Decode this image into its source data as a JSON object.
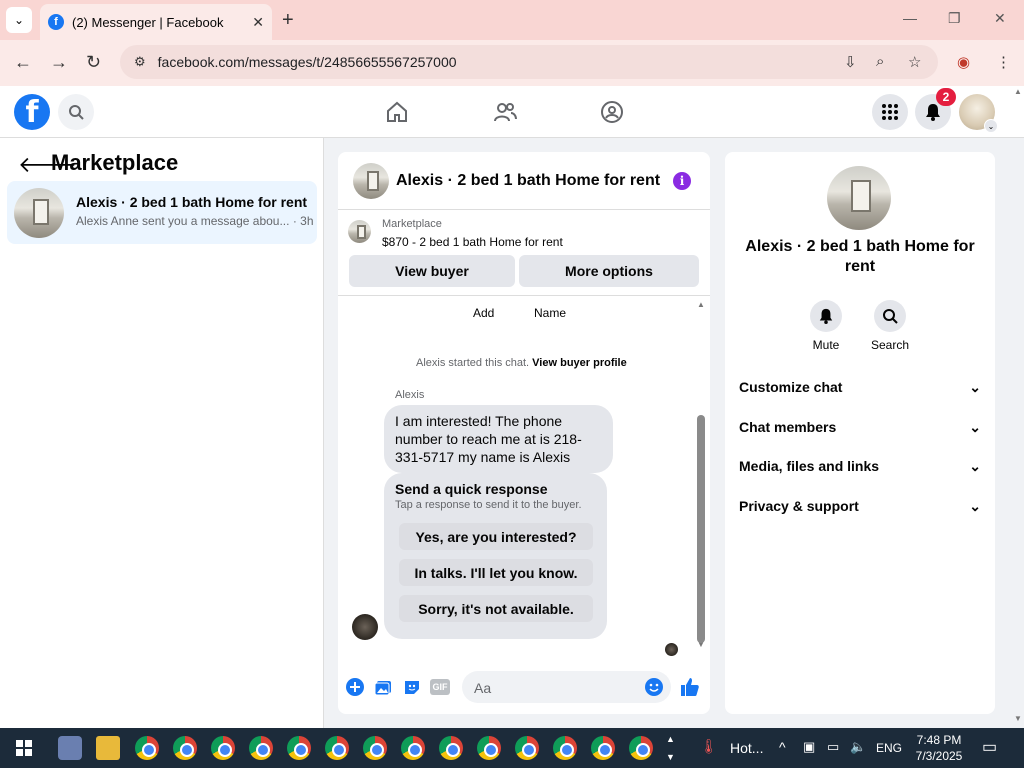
{
  "browser": {
    "tab_title": "(2) Messenger | Facebook",
    "url": "facebook.com/messages/t/24856655567257000"
  },
  "header": {
    "notification_count": "2"
  },
  "left_panel": {
    "title": "Marketplace",
    "conversation": {
      "name": "Alexis · 2 bed 1 bath Home for rent",
      "preview": "Alexis Anne sent you a message abou...",
      "time": "· 3h"
    }
  },
  "chat": {
    "title": "Alexis · 2 bed 1 bath Home for rent",
    "listing_source": "Marketplace",
    "listing_price": "$870 - 2 bed 1 bath Home for rent",
    "view_buyer": "View buyer",
    "more_options": "More options",
    "add_label": "Add",
    "name_label": "Name",
    "system_message": "Alexis started this chat.",
    "view_buyer_profile": "View buyer profile",
    "sender": "Alexis",
    "message": "I am interested! The phone number to reach me at is 218-331-5717 my name is Alexis",
    "quick_response_title": "Send a quick response",
    "quick_response_sub": "Tap a response to send it to the buyer.",
    "quick_responses": [
      "Yes, are you interested?",
      "In talks. I'll let you know.",
      "Sorry, it's not available."
    ],
    "input_placeholder": "Aa",
    "gif_label": "GIF"
  },
  "right_panel": {
    "name": "Alexis · 2 bed 1 bath Home for rent",
    "mute": "Mute",
    "search": "Search",
    "sections": [
      "Customize chat",
      "Chat members",
      "Media, files and links",
      "Privacy & support"
    ]
  },
  "taskbar": {
    "weather": "Hot...",
    "language": "ENG",
    "time": "7:48 PM",
    "date": "7/3/2025"
  },
  "colors": {
    "fb_blue": "#1877f2",
    "info_purple": "#8a2be2",
    "badge_red": "#e41e3f",
    "tab_strip": "#f9d6d3"
  }
}
